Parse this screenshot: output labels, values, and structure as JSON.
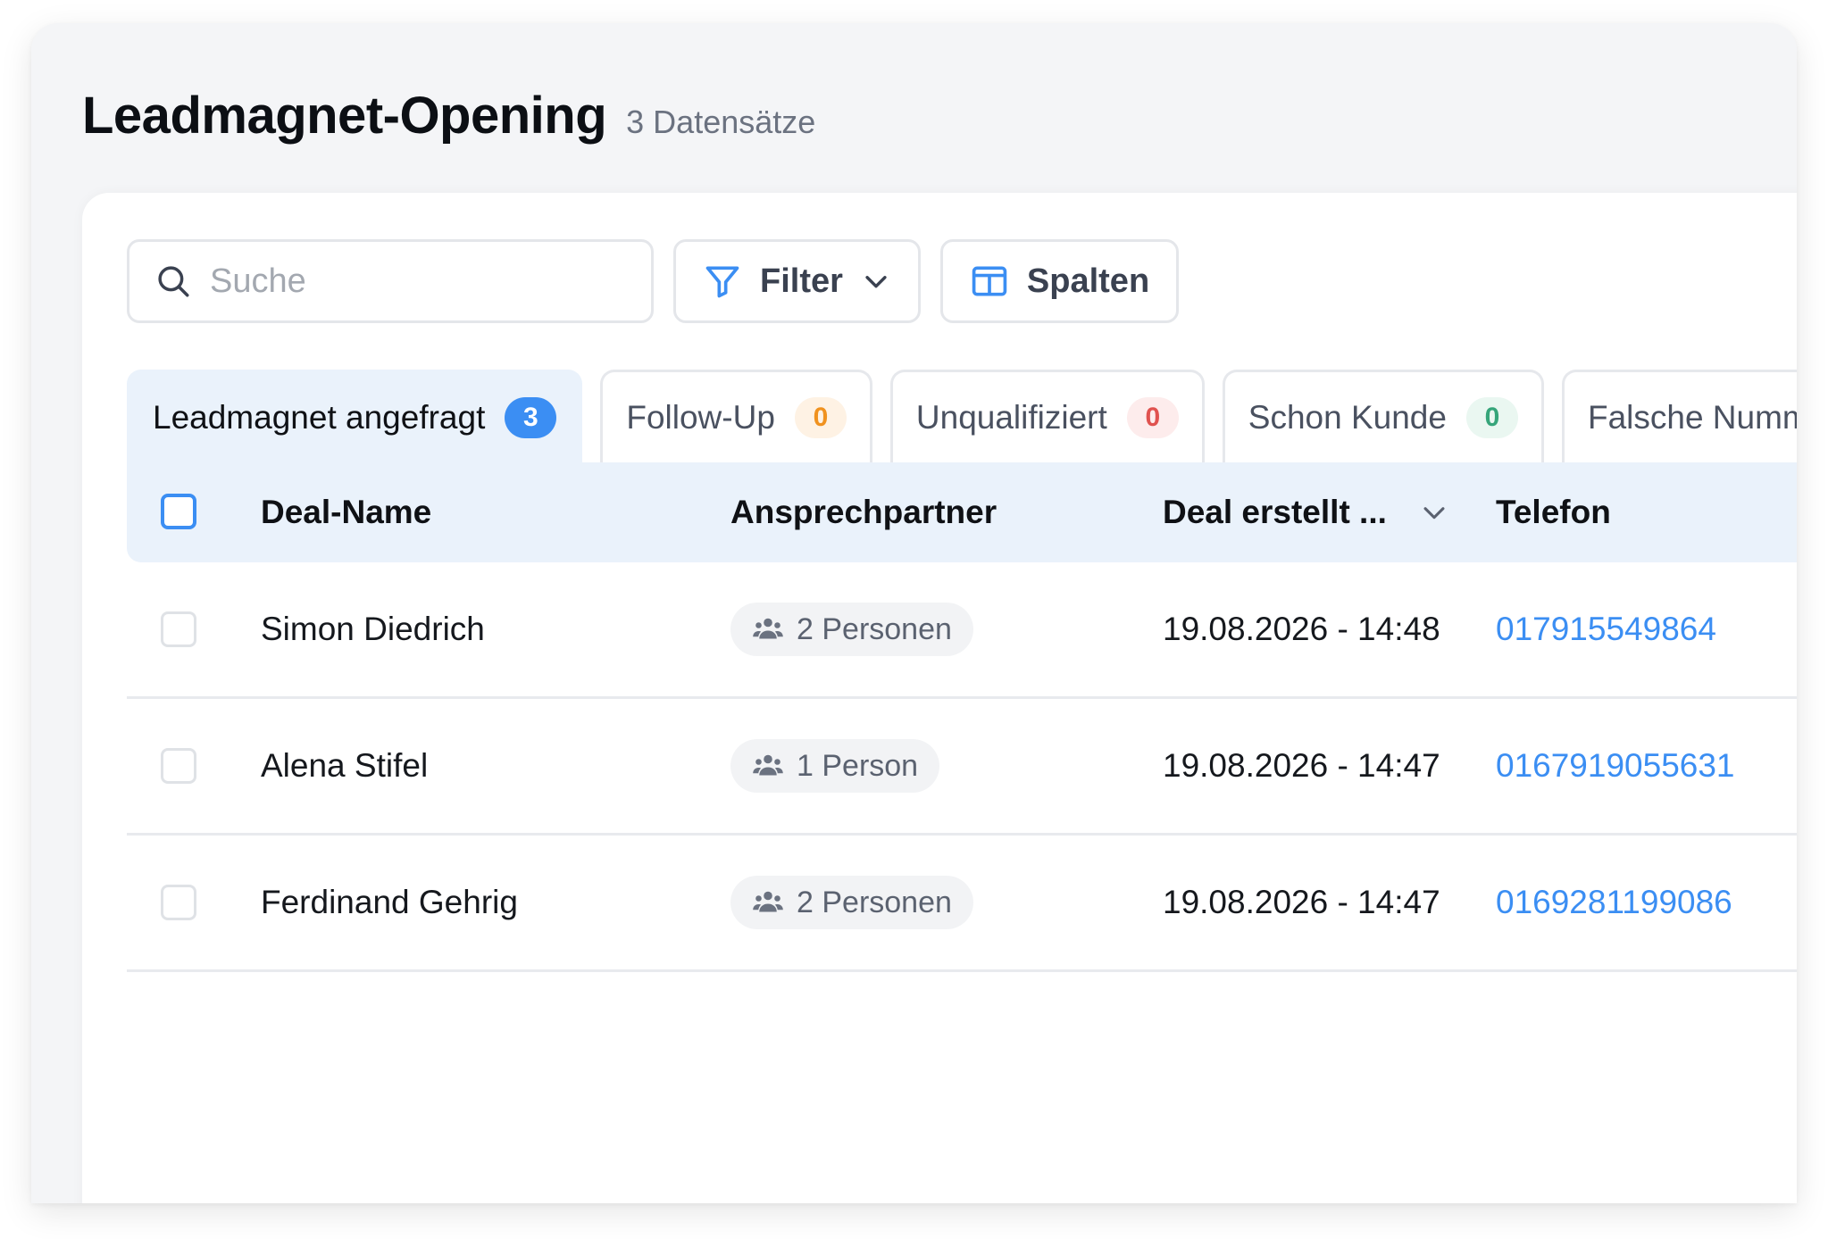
{
  "page": {
    "title": "Leadmagnet-Opening",
    "record_count": "3 Datensätze"
  },
  "toolbar": {
    "search_placeholder": "Suche",
    "filter_label": "Filter",
    "columns_label": "Spalten"
  },
  "tabs": [
    {
      "label": "Leadmagnet angefragt",
      "count": "3",
      "badge_color": "#3b8ef3",
      "active": true
    },
    {
      "label": "Follow-Up",
      "count": "0",
      "badge_color": "#f0921f",
      "active": false
    },
    {
      "label": "Unqualifiziert",
      "count": "0",
      "badge_color": "#e0524f",
      "active": false
    },
    {
      "label": "Schon Kunde",
      "count": "0",
      "badge_color": "#36a57a",
      "active": false
    },
    {
      "label": "Falsche Numm",
      "count": "",
      "active": false
    }
  ],
  "table": {
    "columns": [
      "Deal-Name",
      "Ansprechpartner",
      "Deal erstellt ...",
      "Telefon"
    ],
    "rows": [
      {
        "deal_name": "Simon Diedrich",
        "contacts": "2 Personen",
        "created": "19.08.2026 - 14:48",
        "phone": "017915549864"
      },
      {
        "deal_name": "Alena Stifel",
        "contacts": "1 Person",
        "created": "19.08.2026 - 14:47",
        "phone": "0167919055631"
      },
      {
        "deal_name": "Ferdinand Gehrig",
        "contacts": "2 Personen",
        "created": "19.08.2026 - 14:47",
        "phone": "0169281199086"
      }
    ]
  },
  "icons": {
    "search": "search-icon",
    "filter": "filter-icon",
    "columns": "columns-icon",
    "chevron": "chevron-down-icon",
    "people": "people-icon"
  },
  "colors": {
    "accent": "#3b8ef3",
    "header_bg": "#eaf2fb",
    "link": "#3b8ef3"
  }
}
